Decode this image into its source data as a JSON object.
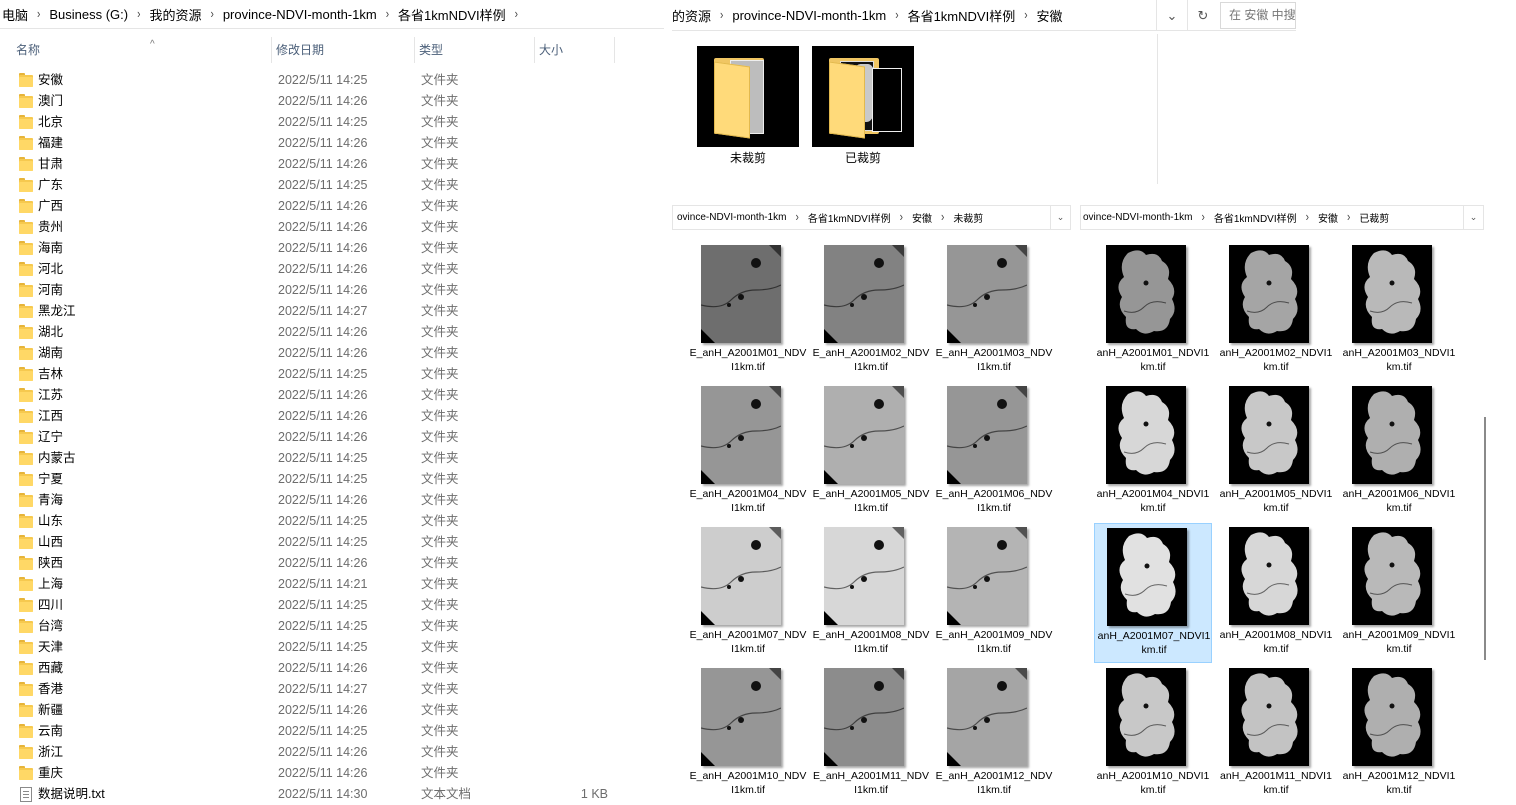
{
  "left": {
    "breadcrumb": [
      "电脑",
      "Business (G:)",
      "我的资源",
      "province-NDVI-month-1km",
      "各省1kmNDVI样例"
    ],
    "columns": {
      "name": "名称",
      "date": "修改日期",
      "type": "类型",
      "size": "大小"
    },
    "rows": [
      {
        "name": "安徽",
        "date": "2022/5/11 14:25",
        "type": "文件夹",
        "size": "",
        "kind": "folder"
      },
      {
        "name": "澳门",
        "date": "2022/5/11 14:26",
        "type": "文件夹",
        "size": "",
        "kind": "folder"
      },
      {
        "name": "北京",
        "date": "2022/5/11 14:25",
        "type": "文件夹",
        "size": "",
        "kind": "folder"
      },
      {
        "name": "福建",
        "date": "2022/5/11 14:26",
        "type": "文件夹",
        "size": "",
        "kind": "folder"
      },
      {
        "name": "甘肃",
        "date": "2022/5/11 14:26",
        "type": "文件夹",
        "size": "",
        "kind": "folder"
      },
      {
        "name": "广东",
        "date": "2022/5/11 14:25",
        "type": "文件夹",
        "size": "",
        "kind": "folder"
      },
      {
        "name": "广西",
        "date": "2022/5/11 14:26",
        "type": "文件夹",
        "size": "",
        "kind": "folder"
      },
      {
        "name": "贵州",
        "date": "2022/5/11 14:26",
        "type": "文件夹",
        "size": "",
        "kind": "folder"
      },
      {
        "name": "海南",
        "date": "2022/5/11 14:26",
        "type": "文件夹",
        "size": "",
        "kind": "folder"
      },
      {
        "name": "河北",
        "date": "2022/5/11 14:26",
        "type": "文件夹",
        "size": "",
        "kind": "folder"
      },
      {
        "name": "河南",
        "date": "2022/5/11 14:26",
        "type": "文件夹",
        "size": "",
        "kind": "folder"
      },
      {
        "name": "黑龙江",
        "date": "2022/5/11 14:27",
        "type": "文件夹",
        "size": "",
        "kind": "folder"
      },
      {
        "name": "湖北",
        "date": "2022/5/11 14:26",
        "type": "文件夹",
        "size": "",
        "kind": "folder"
      },
      {
        "name": "湖南",
        "date": "2022/5/11 14:26",
        "type": "文件夹",
        "size": "",
        "kind": "folder"
      },
      {
        "name": "吉林",
        "date": "2022/5/11 14:25",
        "type": "文件夹",
        "size": "",
        "kind": "folder"
      },
      {
        "name": "江苏",
        "date": "2022/5/11 14:26",
        "type": "文件夹",
        "size": "",
        "kind": "folder"
      },
      {
        "name": "江西",
        "date": "2022/5/11 14:26",
        "type": "文件夹",
        "size": "",
        "kind": "folder"
      },
      {
        "name": "辽宁",
        "date": "2022/5/11 14:26",
        "type": "文件夹",
        "size": "",
        "kind": "folder"
      },
      {
        "name": "内蒙古",
        "date": "2022/5/11 14:25",
        "type": "文件夹",
        "size": "",
        "kind": "folder"
      },
      {
        "name": "宁夏",
        "date": "2022/5/11 14:25",
        "type": "文件夹",
        "size": "",
        "kind": "folder"
      },
      {
        "name": "青海",
        "date": "2022/5/11 14:26",
        "type": "文件夹",
        "size": "",
        "kind": "folder"
      },
      {
        "name": "山东",
        "date": "2022/5/11 14:25",
        "type": "文件夹",
        "size": "",
        "kind": "folder"
      },
      {
        "name": "山西",
        "date": "2022/5/11 14:25",
        "type": "文件夹",
        "size": "",
        "kind": "folder"
      },
      {
        "name": "陕西",
        "date": "2022/5/11 14:26",
        "type": "文件夹",
        "size": "",
        "kind": "folder"
      },
      {
        "name": "上海",
        "date": "2022/5/11 14:21",
        "type": "文件夹",
        "size": "",
        "kind": "folder"
      },
      {
        "name": "四川",
        "date": "2022/5/11 14:25",
        "type": "文件夹",
        "size": "",
        "kind": "folder"
      },
      {
        "name": "台湾",
        "date": "2022/5/11 14:25",
        "type": "文件夹",
        "size": "",
        "kind": "folder"
      },
      {
        "name": "天津",
        "date": "2022/5/11 14:25",
        "type": "文件夹",
        "size": "",
        "kind": "folder"
      },
      {
        "name": "西藏",
        "date": "2022/5/11 14:26",
        "type": "文件夹",
        "size": "",
        "kind": "folder"
      },
      {
        "name": "香港",
        "date": "2022/5/11 14:27",
        "type": "文件夹",
        "size": "",
        "kind": "folder"
      },
      {
        "name": "新疆",
        "date": "2022/5/11 14:26",
        "type": "文件夹",
        "size": "",
        "kind": "folder"
      },
      {
        "name": "云南",
        "date": "2022/5/11 14:25",
        "type": "文件夹",
        "size": "",
        "kind": "folder"
      },
      {
        "name": "浙江",
        "date": "2022/5/11 14:26",
        "type": "文件夹",
        "size": "",
        "kind": "folder"
      },
      {
        "name": "重庆",
        "date": "2022/5/11 14:26",
        "type": "文件夹",
        "size": "",
        "kind": "folder"
      },
      {
        "name": "数据说明.txt",
        "date": "2022/5/11 14:30",
        "type": "文本文档",
        "size": "1 KB",
        "kind": "text"
      }
    ]
  },
  "topright": {
    "breadcrumb": [
      "的资源",
      "province-NDVI-month-1km",
      "各省1kmNDVI样例",
      "安徽"
    ],
    "search_placeholder": "在 安徽 中搜",
    "folders": [
      {
        "label": "未裁剪"
      },
      {
        "label": "已裁剪"
      }
    ]
  },
  "uncropped": {
    "breadcrumb": [
      "ovince-NDVI-month-1km",
      "各省1kmNDVI样例",
      "安徽",
      "未裁剪"
    ],
    "files": [
      {
        "line1": "E_anH_A2001M01_NDV",
        "line2": "I1km.tif"
      },
      {
        "line1": "E_anH_A2001M02_NDV",
        "line2": "I1km.tif"
      },
      {
        "line1": "E_anH_A2001M03_NDV",
        "line2": "I1km.tif"
      },
      {
        "line1": "E_anH_A2001M04_NDV",
        "line2": "I1km.tif"
      },
      {
        "line1": "E_anH_A2001M05_NDV",
        "line2": "I1km.tif"
      },
      {
        "line1": "E_anH_A2001M06_NDV",
        "line2": "I1km.tif"
      },
      {
        "line1": "E_anH_A2001M07_NDV",
        "line2": "I1km.tif"
      },
      {
        "line1": "E_anH_A2001M08_NDV",
        "line2": "I1km.tif"
      },
      {
        "line1": "E_anH_A2001M09_NDV",
        "line2": "I1km.tif"
      },
      {
        "line1": "E_anH_A2001M10_NDV",
        "line2": "I1km.tif"
      },
      {
        "line1": "E_anH_A2001M11_NDV",
        "line2": "I1km.tif"
      },
      {
        "line1": "E_anH_A2001M12_NDV",
        "line2": "I1km.tif"
      }
    ]
  },
  "cropped": {
    "breadcrumb": [
      "ovince-NDVI-month-1km",
      "各省1kmNDVI样例",
      "安徽",
      "已裁剪"
    ],
    "selected_index": 6,
    "files": [
      {
        "line1": "anH_A2001M01_NDVI1",
        "line2": "km.tif"
      },
      {
        "line1": "anH_A2001M02_NDVI1",
        "line2": "km.tif"
      },
      {
        "line1": "anH_A2001M03_NDVI1",
        "line2": "km.tif"
      },
      {
        "line1": "anH_A2001M04_NDVI1",
        "line2": "km.tif"
      },
      {
        "line1": "anH_A2001M05_NDVI1",
        "line2": "km.tif"
      },
      {
        "line1": "anH_A2001M06_NDVI1",
        "line2": "km.tif"
      },
      {
        "line1": "anH_A2001M07_NDVI1",
        "line2": "km.tif"
      },
      {
        "line1": "anH_A2001M08_NDVI1",
        "line2": "km.tif"
      },
      {
        "line1": "anH_A2001M09_NDVI1",
        "line2": "km.tif"
      },
      {
        "line1": "anH_A2001M10_NDVI1",
        "line2": "km.tif"
      },
      {
        "line1": "anH_A2001M11_NDVI1",
        "line2": "km.tif"
      },
      {
        "line1": "anH_A2001M12_NDVI1",
        "line2": "km.tif"
      }
    ]
  },
  "colors": {
    "folder": "#ffd866",
    "selection": "#cce8ff",
    "header_text": "#4c607a",
    "meta_text": "#6d6d6d"
  }
}
